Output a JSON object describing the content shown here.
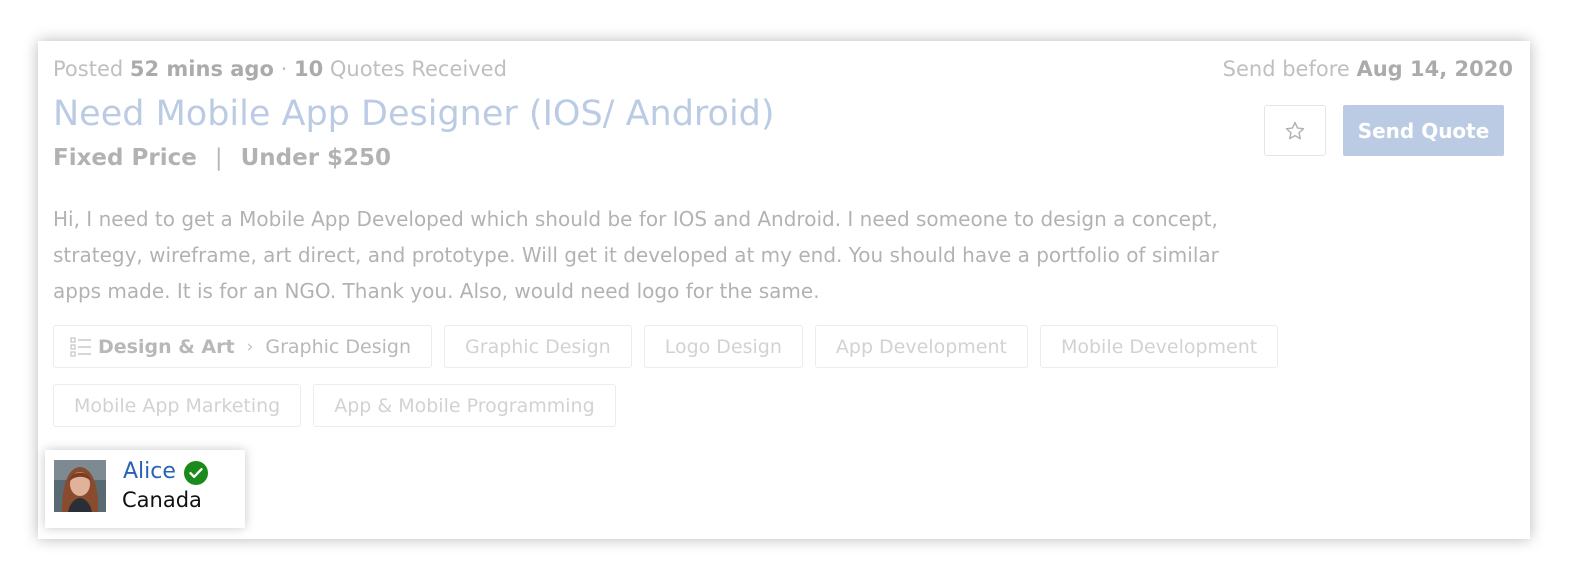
{
  "job": {
    "meta": {
      "posted_prefix": "Posted",
      "posted_ago": "52 mins ago",
      "dot": "·",
      "quotes_count": "10",
      "quotes_label": "Quotes Received"
    },
    "deadline": {
      "prefix": "Send before",
      "date": "Aug 14, 2020"
    },
    "title": "Need Mobile App Designer (IOS/ Android)",
    "price_type": "Fixed Price",
    "price_sep": "|",
    "budget": "Under $250",
    "description": "Hi, I need to get a Mobile App Developed which should be for IOS and Android. I need someone to design a concept, strategy, wireframe, art direct, and prototype. Will get it developed at my end. You should have a portfolio of similar apps made. It is for an NGO. Thank you. Also, would need logo for the same.",
    "category": {
      "main": "Design & Art",
      "arrow": "›",
      "sub": "Graphic Design"
    },
    "skills": [
      "Graphic Design",
      "Logo Design",
      "App Development",
      "Mobile Development",
      "Mobile App Marketing",
      "App & Mobile Programming"
    ],
    "actions": {
      "favorite_icon": "star-icon",
      "send_quote_label": "Send Quote"
    }
  },
  "user": {
    "name": "Alice",
    "country": "Canada",
    "verified_icon": "check-circle-icon",
    "verified_color": "#1a8a1a"
  },
  "colors": {
    "accent": "#4a76b8",
    "link": "#2a63b5"
  }
}
